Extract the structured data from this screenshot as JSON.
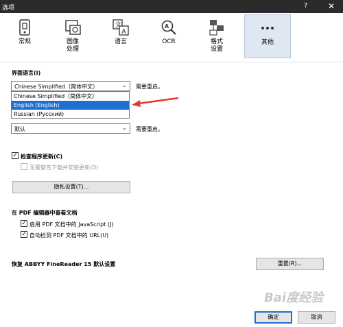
{
  "window": {
    "title": "选项",
    "help": "?",
    "close": "✕"
  },
  "toolbar": [
    {
      "label": "常规",
      "icon": "phone-icon"
    },
    {
      "label": "图像\n处理",
      "icon": "image-processing-icon"
    },
    {
      "label": "语言",
      "icon": "language-icon"
    },
    {
      "label": "OCR",
      "icon": "ocr-magnifier-icon"
    },
    {
      "label": "格式\n设置",
      "icon": "format-icon"
    },
    {
      "label": "其他",
      "icon": "more-icon",
      "active": true
    }
  ],
  "interface_language": {
    "label": "界面语言(I)",
    "selected": "Chinese Simplified（简体中文）",
    "note": "需要重启。",
    "options": [
      "Chinese Simplified（简体中文）",
      "English (English)",
      "Russian (Русский)"
    ],
    "highlighted_index": 1
  },
  "second_combo": {
    "selected": "默认",
    "note": "需要重启。"
  },
  "updates": {
    "check_label": "检查程序更新(C)",
    "check_checked": true,
    "no_warn_label": "无需警告下载并安装更新(D)",
    "no_warn_checked": false,
    "privacy_button": "隐私设置(T)..."
  },
  "pdf_editor": {
    "heading": "在 PDF 编辑器中查看文档",
    "js_label": "启用 PDF 文档中的 JavaScript (J)",
    "js_checked": true,
    "url_label": "自动检测 PDF 文档中的 URL(U)",
    "url_checked": true
  },
  "restore": {
    "label": "恢复 ABBYY FineReader 15 默认设置",
    "button": "重置(R)..."
  },
  "footer": {
    "ok": "确定",
    "cancel": "取消"
  },
  "watermark": "Bai度经验",
  "colors": {
    "titlebar": "#2b2b2b",
    "accent": "#1e6fd1",
    "arrow": "#e53935",
    "active_tab": "#dfe7f3"
  }
}
